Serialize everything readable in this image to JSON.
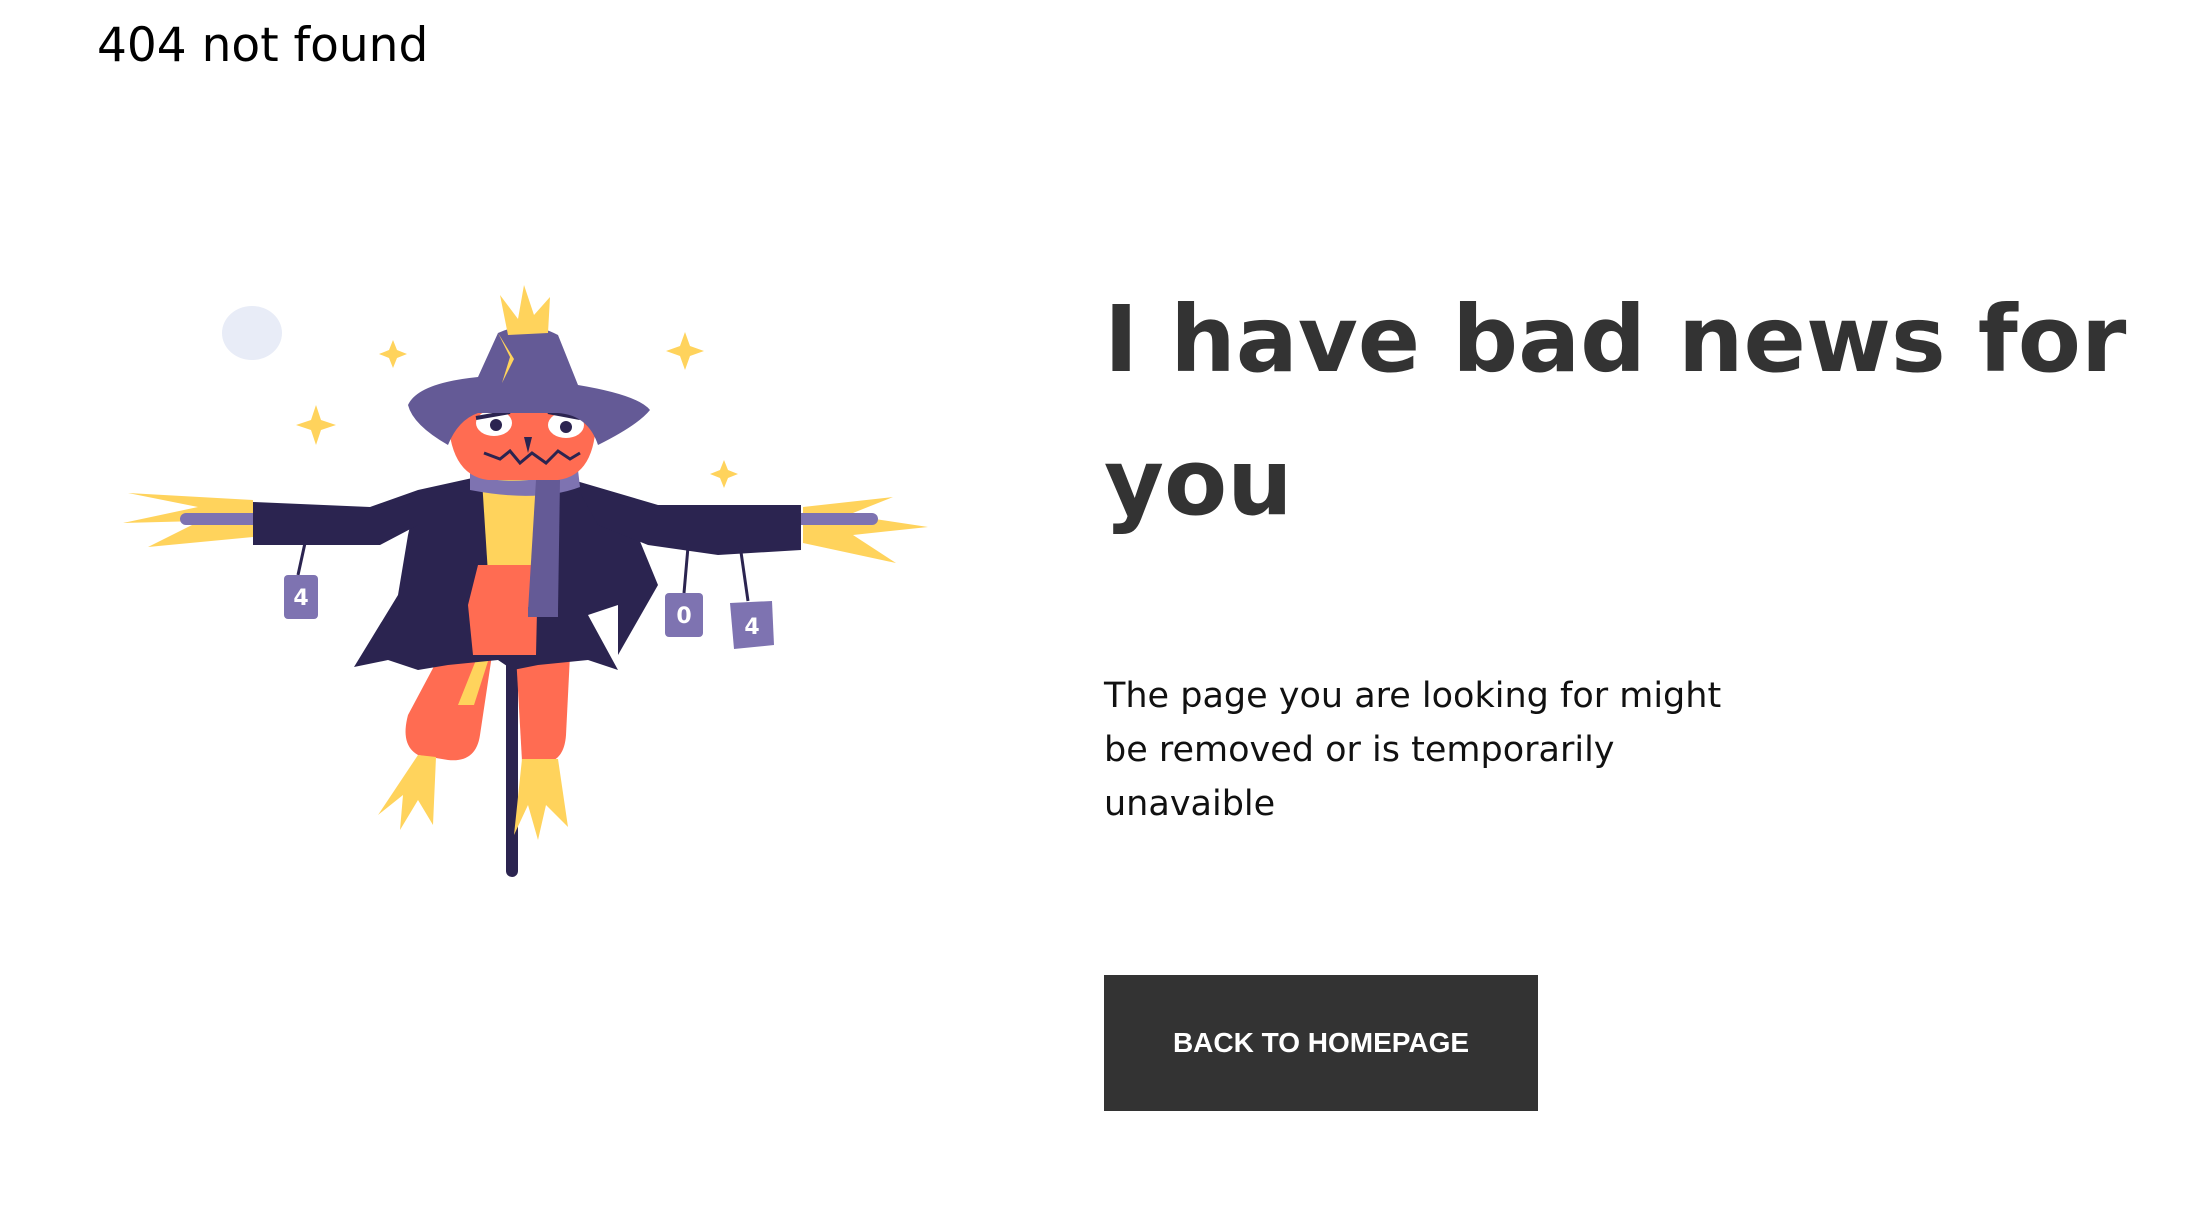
{
  "header": {
    "site_title": "404 not found"
  },
  "illustration": {
    "subject": "scarecrow-illustration",
    "cans": [
      "4",
      "0",
      "4"
    ]
  },
  "main": {
    "headline": "I have bad news for you",
    "message": "The page you are looking for might be removed or is temporarily unavaible",
    "button_label": "BACK TO HOMEPAGE"
  },
  "colors": {
    "text_dark": "#333333",
    "button_bg": "#333333",
    "button_text": "#ffffff",
    "coat": "#2B2450",
    "hat": "#645A96",
    "face": "#FF6C52",
    "straw": "#FFD35C",
    "moon": "#E8ECF7"
  }
}
